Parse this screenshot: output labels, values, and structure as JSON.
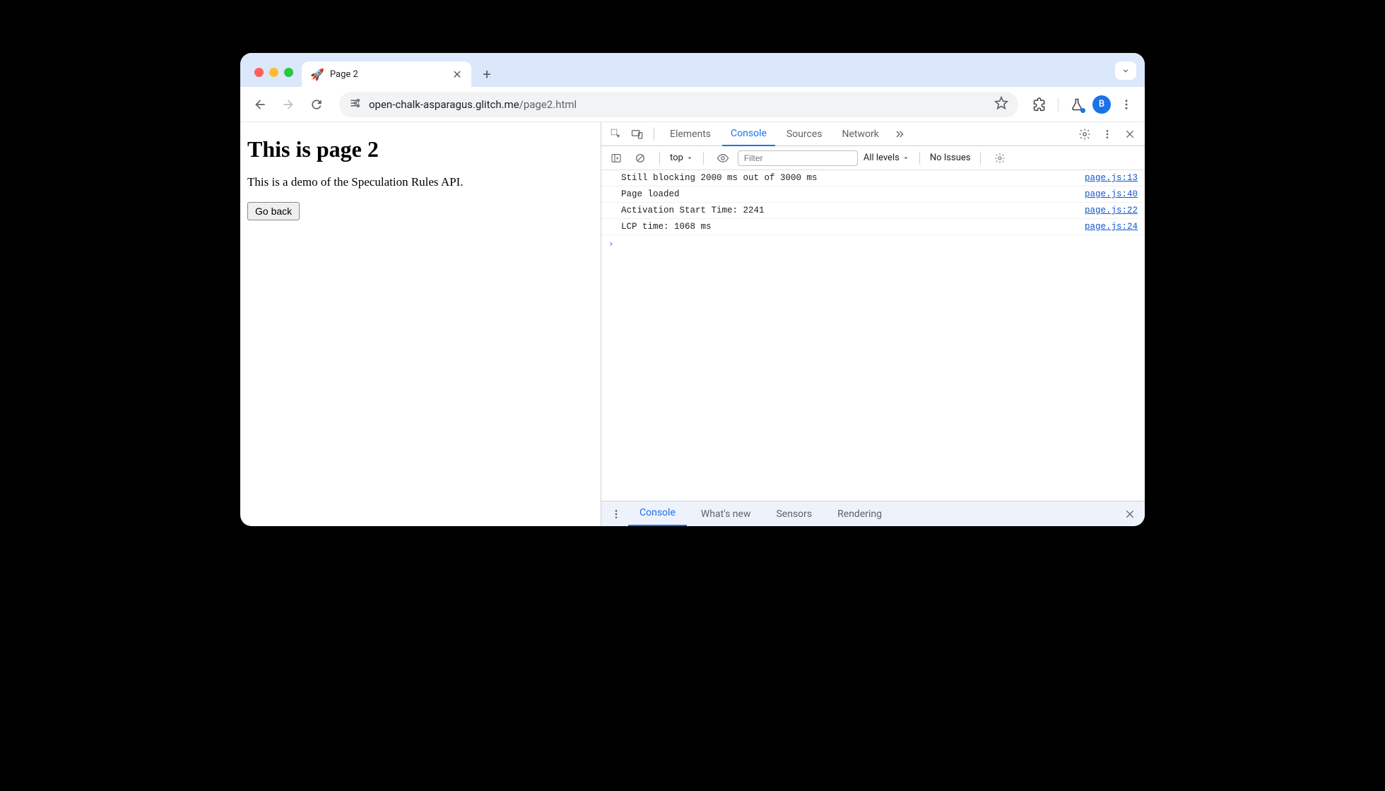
{
  "browser": {
    "tab": {
      "favicon": "🚀",
      "title": "Page 2"
    },
    "url": {
      "host": "open-chalk-asparagus.glitch.me",
      "path": "/page2.html"
    },
    "avatar_letter": "B"
  },
  "page": {
    "heading": "This is page 2",
    "paragraph": "This is a demo of the Speculation Rules API.",
    "button_label": "Go back"
  },
  "devtools": {
    "tabs": [
      "Elements",
      "Console",
      "Sources",
      "Network"
    ],
    "active_tab": "Console",
    "console_toolbar": {
      "context": "top",
      "filter_placeholder": "Filter",
      "levels": "All levels",
      "issues": "No Issues"
    },
    "console_rows": [
      {
        "msg": "Still blocking 2000 ms out of 3000 ms",
        "src": "page.js:13"
      },
      {
        "msg": "Page loaded",
        "src": "page.js:40"
      },
      {
        "msg": "Activation Start Time: 2241",
        "src": "page.js:22"
      },
      {
        "msg": "LCP time: 1068 ms",
        "src": "page.js:24"
      }
    ],
    "prompt": "›",
    "drawer_tabs": [
      "Console",
      "What's new",
      "Sensors",
      "Rendering"
    ],
    "active_drawer_tab": "Console"
  }
}
